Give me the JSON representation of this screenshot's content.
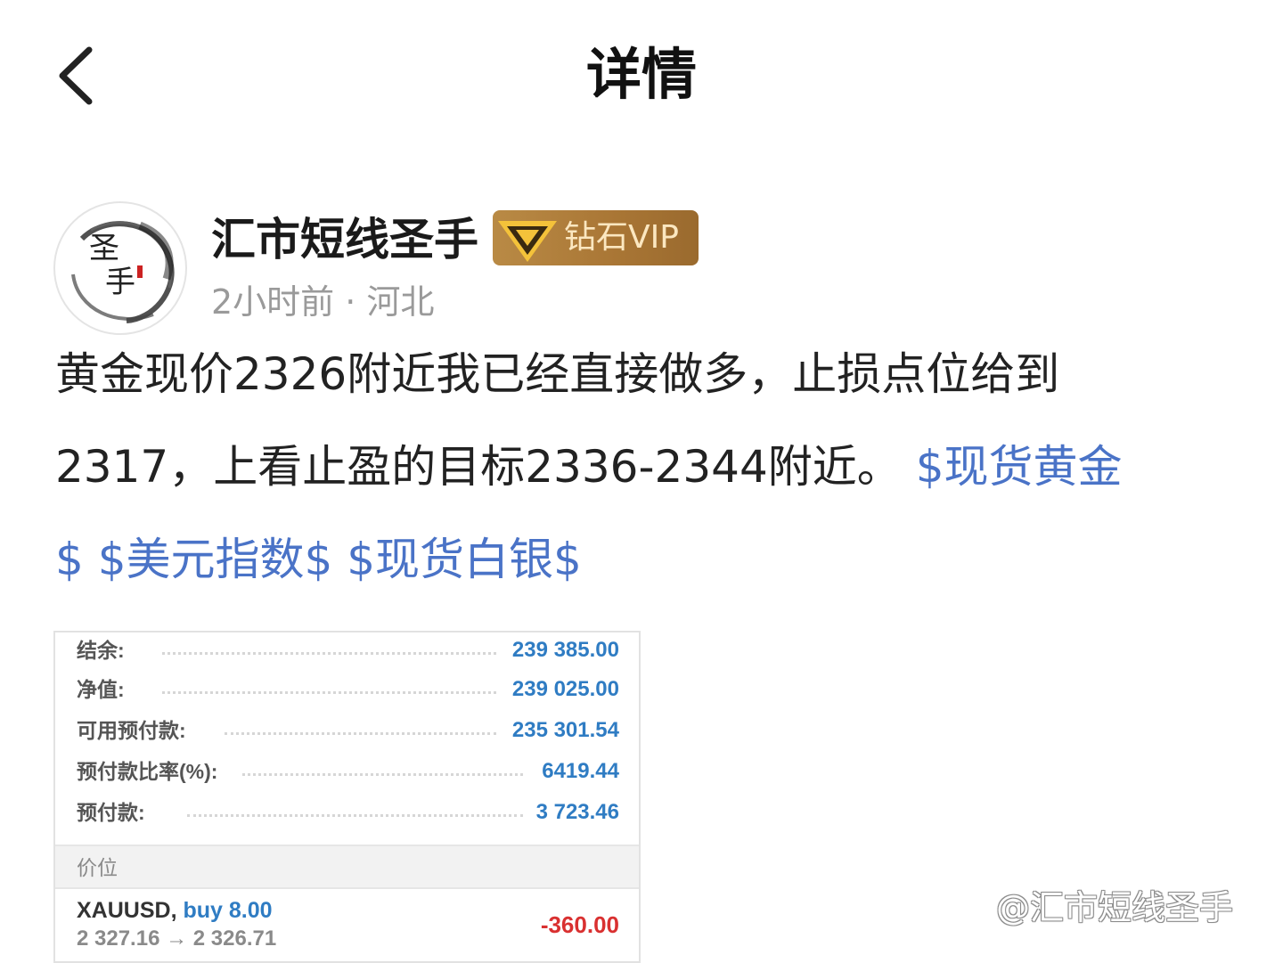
{
  "header": {
    "title": "详情",
    "back_icon": "chevron-left-icon"
  },
  "author": {
    "name": "汇市短线圣手",
    "badge_label": "钻石VIP",
    "badge_icon": "diamond-icon",
    "time": "2小时前",
    "separator": "·",
    "location": "河北",
    "avatar_text_top": "圣",
    "avatar_text_bottom": "手"
  },
  "post": {
    "line1": "黄金现价2326附近我已经直接做多，止损点位给到",
    "line2": "2317，上看止盈的目标2336-2344附近。",
    "tags": [
      "$现货黄金",
      "$",
      "$美元指数$",
      "$现货白银$"
    ]
  },
  "account": {
    "rows": [
      {
        "label": "结余:",
        "value": "239 385.00"
      },
      {
        "label": "净值:",
        "value": "239 025.00"
      },
      {
        "label": "可用预付款:",
        "value": "235 301.54"
      },
      {
        "label": "预付款比率(%):",
        "value": "6419.44"
      },
      {
        "label": "预付款:",
        "value": "3 723.46"
      }
    ],
    "section_label": "价位",
    "position": {
      "symbol": "XAUUSD,",
      "side": "buy 8.00",
      "prices": "2 327.16 → 2 326.71",
      "pl": "-360.00"
    }
  },
  "watermark": "@汇市短线圣手",
  "colors": {
    "tag": "#4a73c7",
    "value_blue": "#2f7cc3",
    "loss_red": "#d93030",
    "badge_gold": "#a97635"
  }
}
